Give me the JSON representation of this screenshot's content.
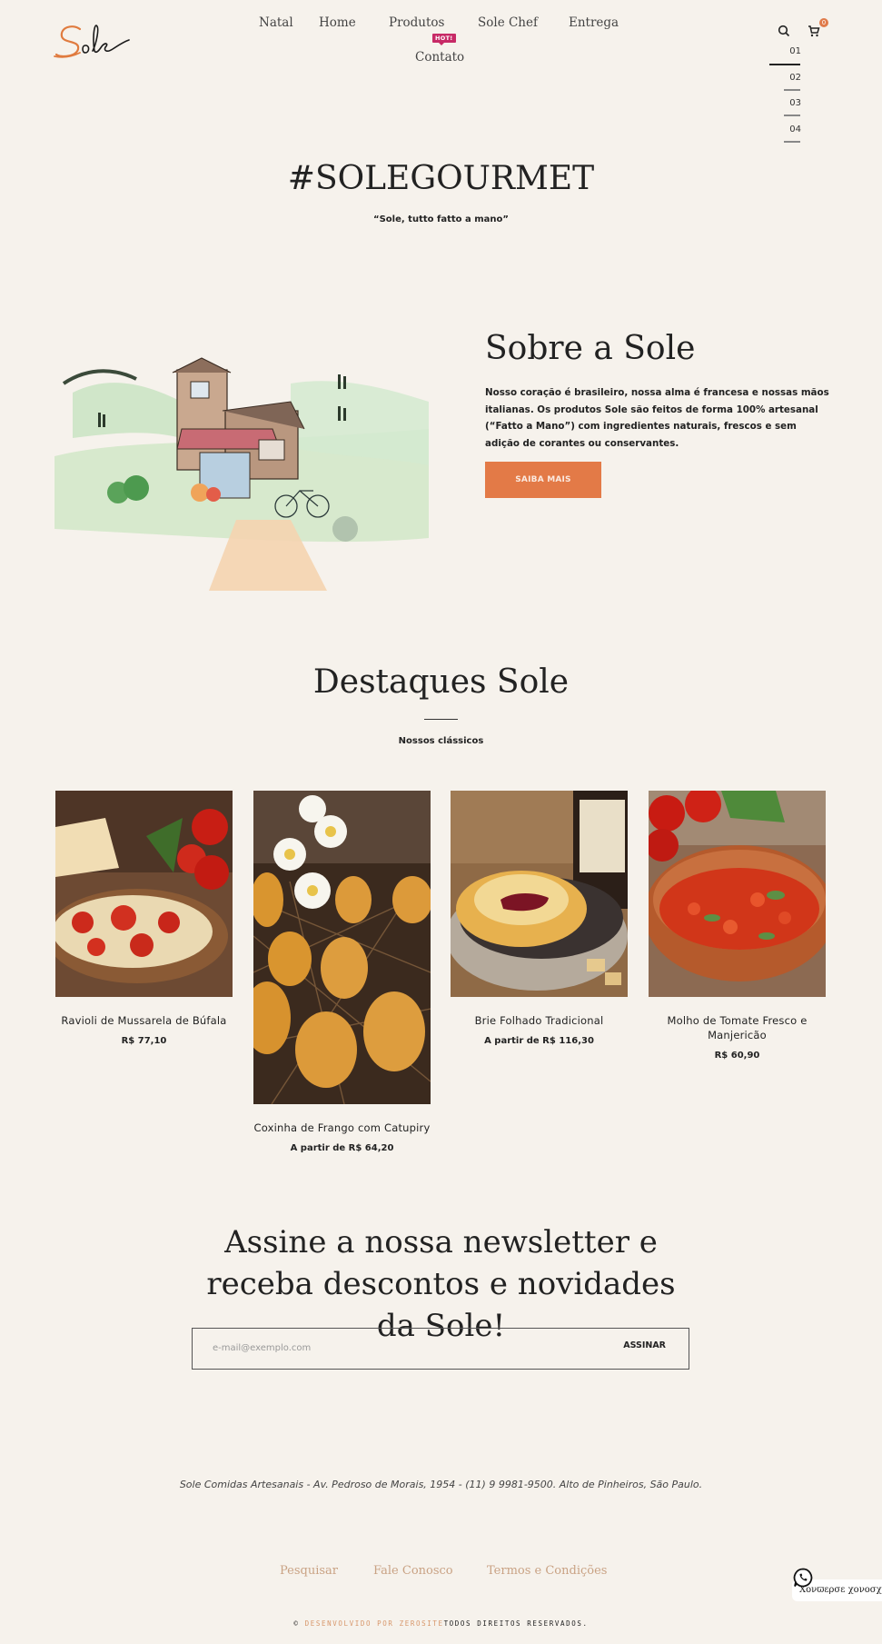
{
  "brand": {
    "logo_text": "Sole",
    "accent_color": "#e37a47",
    "hot_color": "#c72a66"
  },
  "nav": {
    "items": [
      {
        "label": "Natal"
      },
      {
        "label": "Home"
      },
      {
        "label": "Produtos",
        "badge": "HOT!"
      },
      {
        "label": "Sole Chef"
      },
      {
        "label": "Entrega"
      },
      {
        "label": "Contato"
      }
    ],
    "search_icon": "search-icon",
    "cart_icon": "cart-icon",
    "cart_count": "0"
  },
  "slider": {
    "pages": [
      "01",
      "02",
      "03",
      "04"
    ],
    "active": "01"
  },
  "hero": {
    "title": "#SOLEGOURMET",
    "subtitle": "“Sole, tutto fatto a mano”"
  },
  "about": {
    "title": "Sobre a Sole",
    "text": "Nosso coração é brasileiro, nossa alma é francesa e nossas mãos italianas. Os produtos Sole são feitos de forma 100% artesanal (“Fatto a Mano”) com ingredientes naturais, frescos e sem adição de corantes ou conservantes.",
    "button": "SAIBA MAIS"
  },
  "highlights": {
    "title": "Destaques Sole",
    "subtitle": "Nossos clássicos",
    "products": [
      {
        "name": "Ravioli de Mussarela de Búfala",
        "price": "R$ 77,10"
      },
      {
        "name": "Coxinha de Frango com Catupiry",
        "price": "A partir de R$ 64,20"
      },
      {
        "name": "Brie Folhado Tradicional",
        "price": "A partir de R$ 116,30"
      },
      {
        "name": "Molho de Tomate Fresco e Manjericão",
        "price": "R$ 60,90"
      }
    ]
  },
  "newsletter": {
    "title": "Assine a nossa newsletter e receba descontos e novidades da Sole!",
    "placeholder": "e-mail@exemplo.com",
    "value": "",
    "button": "ASSINAR"
  },
  "footer": {
    "address": "Sole Comidas Artesanais - Av. Pedroso de Morais, 1954 - (11) 9 9981-9500. Alto de Pinheiros, São Paulo.",
    "links": [
      "Pesquisar",
      "Fale Conosco",
      "Termos e Condições"
    ],
    "copyright_symbol": "©",
    "developer": "DESENVOLVIDO POR ZEROSITE",
    "rights": "TODOS DIREITOS RESERVADOS."
  },
  "whatsapp": {
    "label": "Χονϖερσε χονοσχο"
  }
}
